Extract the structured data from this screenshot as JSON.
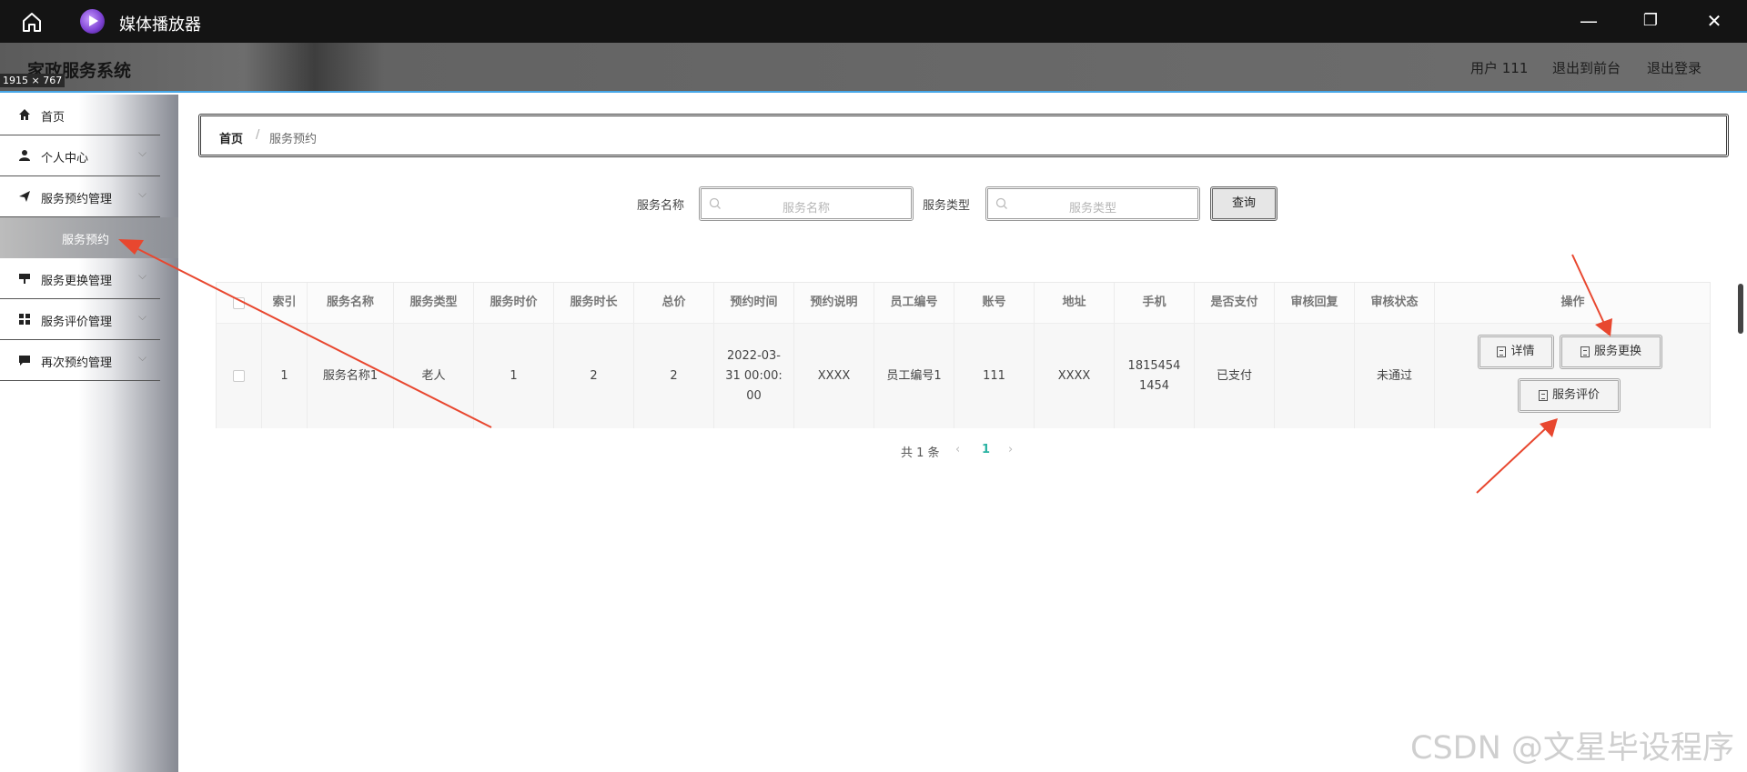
{
  "window": {
    "app_title": "媒体播放器",
    "minimize": "—",
    "maximize": "❐",
    "close": "✕"
  },
  "header": {
    "brand": "家政服务系统",
    "size_tag": "1915 × 767",
    "user": "用户 111",
    "to_front": "退出到前台",
    "logout": "退出登录"
  },
  "sidebar": {
    "items": [
      {
        "label": "首页",
        "icon": "home-icon"
      },
      {
        "label": "个人中心",
        "icon": "user-icon"
      },
      {
        "label": "服务预约管理",
        "icon": "send-icon"
      },
      {
        "label": "服务更换管理",
        "icon": "sign-icon"
      },
      {
        "label": "服务评价管理",
        "icon": "grid-icon"
      },
      {
        "label": "再次预约管理",
        "icon": "chat-icon"
      }
    ],
    "active_sub": "服务预约"
  },
  "breadcrumb": {
    "home": "首页",
    "separator": "/",
    "current": "服务预约"
  },
  "search": {
    "name_label": "服务名称",
    "name_placeholder": "服务名称",
    "type_label": "服务类型",
    "type_placeholder": "服务类型",
    "query_button": "查询"
  },
  "table": {
    "headers": [
      "",
      "索引",
      "服务名称",
      "服务类型",
      "服务时价",
      "服务时长",
      "总价",
      "预约时间",
      "预约说明",
      "员工编号",
      "账号",
      "地址",
      "手机",
      "是否支付",
      "审核回复",
      "审核状态",
      "操作"
    ],
    "rows": [
      {
        "index": "1",
        "service_name": "服务名称1",
        "service_type": "老人",
        "hourly_price": "1",
        "duration": "2",
        "total": "2",
        "appointment_time": "2022-03-31 00:00:00",
        "note": "XXXX",
        "staff_no": "员工编号1",
        "account": "111",
        "address": "XXXX",
        "phone": "18154541454",
        "paid": "已支付",
        "review_reply": "",
        "review_status": "未通过",
        "actions": {
          "detail": "详情",
          "replace": "服务更换",
          "evaluate": "服务评价"
        }
      }
    ]
  },
  "pagination": {
    "total": "共 1 条",
    "prev": "‹",
    "current": "1",
    "next": "›"
  },
  "watermark": "CSDN @文星毕设程序",
  "colors": {
    "header_underline": "#47a7e8",
    "annotation_arrow": "#e8472f",
    "active_page": "#2bb3a3"
  }
}
